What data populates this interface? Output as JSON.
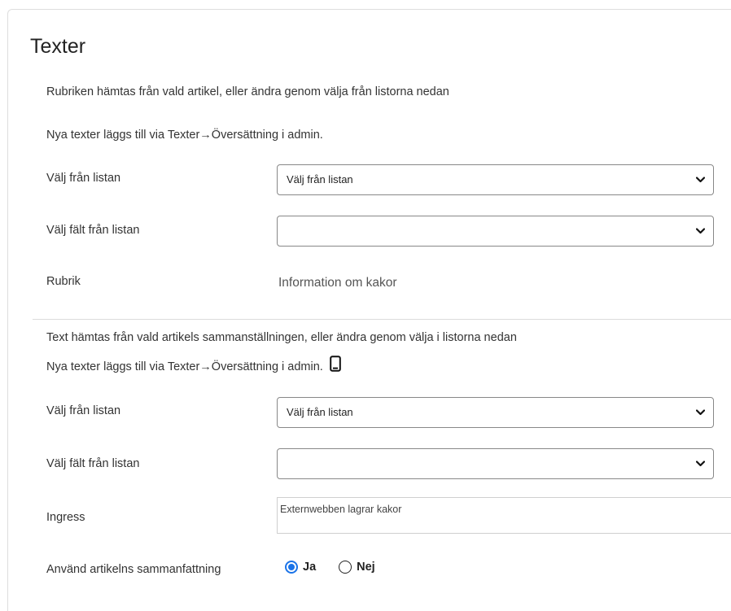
{
  "section": {
    "title": "Texter"
  },
  "rubrik_block": {
    "info_line_1": "Rubriken hämtas från vald artikel, eller ändra genom välja från listorna nedan",
    "info_line_2": "Nya texter läggs till via Texter→Översättning i admin.",
    "list_label": "Välj från listan",
    "list_value": "Välj från listan",
    "field_label": "Välj fält från listan",
    "field_value": "",
    "rubrik_label": "Rubrik",
    "rubrik_value": "Information om kakor"
  },
  "ingress_block": {
    "info_line_1": "Text hämtas från vald artikels sammanställningen, eller ändra genom välja i listorna nedan",
    "info_line_2": "Nya texter läggs till via Texter→Översättning i admin.",
    "list_label": "Välj från listan",
    "list_value": "Välj från listan",
    "field_label": "Välj fält från listan",
    "field_value": "",
    "ingress_label": "Ingress",
    "ingress_value": "Externwebben lagrar kakor",
    "summary_label": "Använd artikelns sammanfattning",
    "radio_yes": "Ja",
    "radio_no": "Nej",
    "selected": "Ja"
  },
  "icons": {
    "phone": "mobile-phone-icon",
    "dropdown": "chevron-down-icon"
  },
  "colors": {
    "radio_accent": "#1a73e8"
  }
}
